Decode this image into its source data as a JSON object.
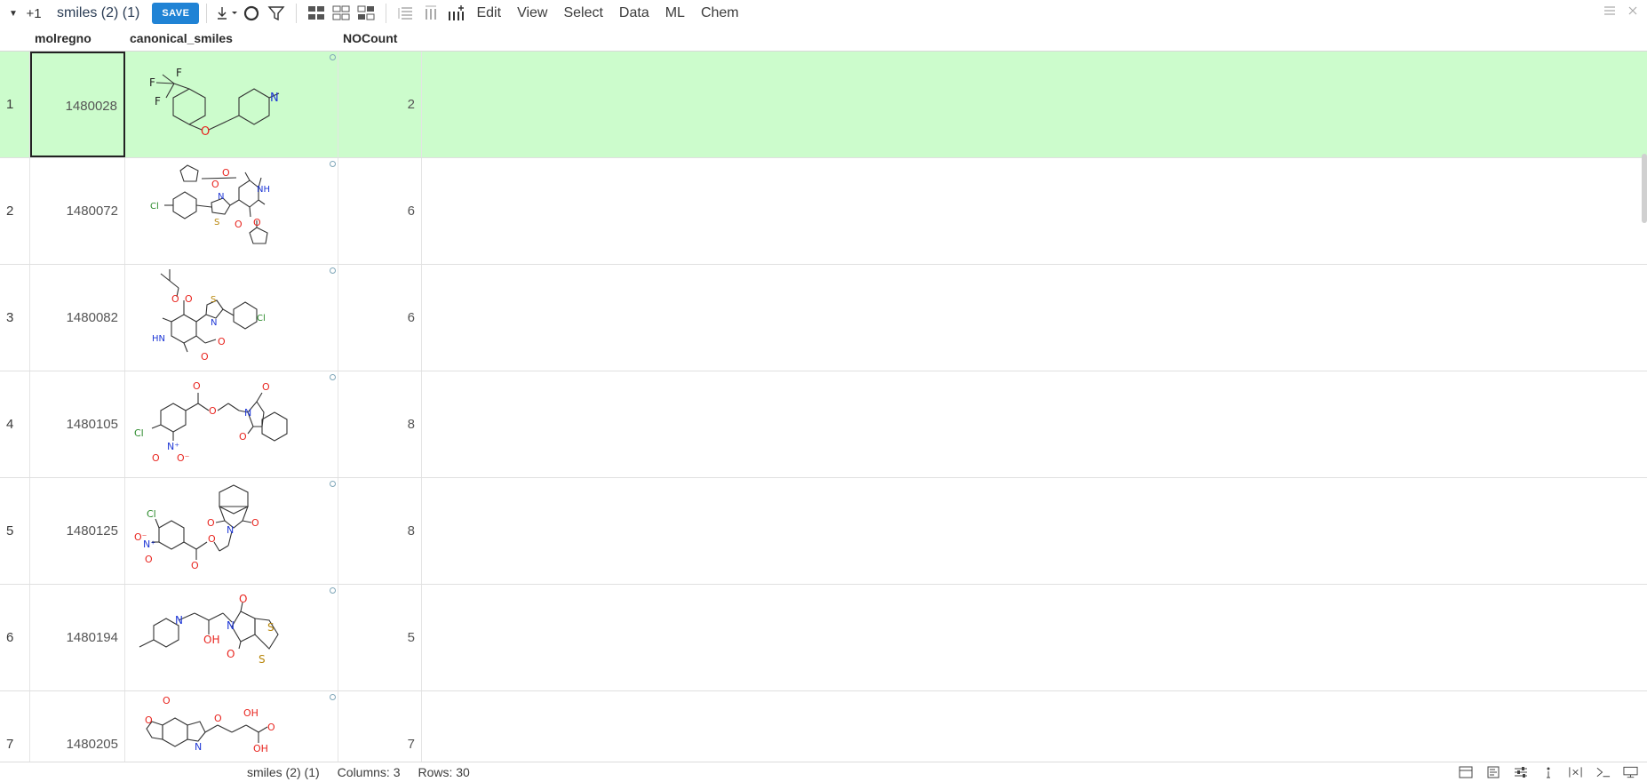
{
  "toolbar": {
    "plus_label": "+1",
    "view_name": "smiles (2) (1)",
    "save_label": "SAVE",
    "menus": [
      "Edit",
      "View",
      "Select",
      "Data",
      "ML",
      "Chem"
    ]
  },
  "grid": {
    "columns": [
      "molregno",
      "canonical_smiles",
      "NOCount"
    ],
    "rows": [
      {
        "num": "1",
        "molregno": "1480028",
        "nocount": "2",
        "selected": true
      },
      {
        "num": "2",
        "molregno": "1480072",
        "nocount": "6"
      },
      {
        "num": "3",
        "molregno": "1480082",
        "nocount": "6"
      },
      {
        "num": "4",
        "molregno": "1480105",
        "nocount": "8"
      },
      {
        "num": "5",
        "molregno": "1480125",
        "nocount": "8"
      },
      {
        "num": "6",
        "molregno": "1480194",
        "nocount": "5"
      },
      {
        "num": "7",
        "molregno": "1480205",
        "nocount": "7"
      }
    ],
    "selected_row_color": "#ccfccc"
  },
  "statusbar": {
    "table_name": "smiles (2) (1)",
    "columns_text": "Columns: 3",
    "rows_text": "Rows: 30"
  },
  "colors": {
    "accent": "#2083d5",
    "atom_o": "#e8251f",
    "atom_n": "#1f38d6",
    "atom_cl": "#2a8a2a"
  }
}
